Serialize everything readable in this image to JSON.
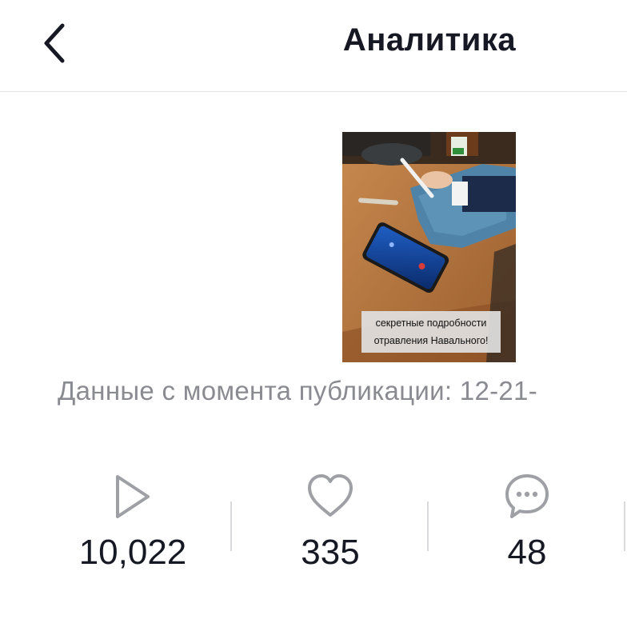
{
  "header": {
    "title": "Аналитика"
  },
  "video": {
    "caption_line1": "секретные подробности",
    "caption_line2": "отравления Навального!"
  },
  "published": {
    "text": "Данные с момента публикации: 12-21-"
  },
  "metrics": [
    {
      "name": "views",
      "icon": "play-icon",
      "value": "10,022"
    },
    {
      "name": "likes",
      "icon": "heart-icon",
      "value": "335"
    },
    {
      "name": "comments",
      "icon": "comment-icon",
      "value": "48"
    }
  ],
  "colors": {
    "text": "#161823",
    "muted": "#8a8b91",
    "icon": "#9fa0a5",
    "divider": "#dadadc"
  }
}
